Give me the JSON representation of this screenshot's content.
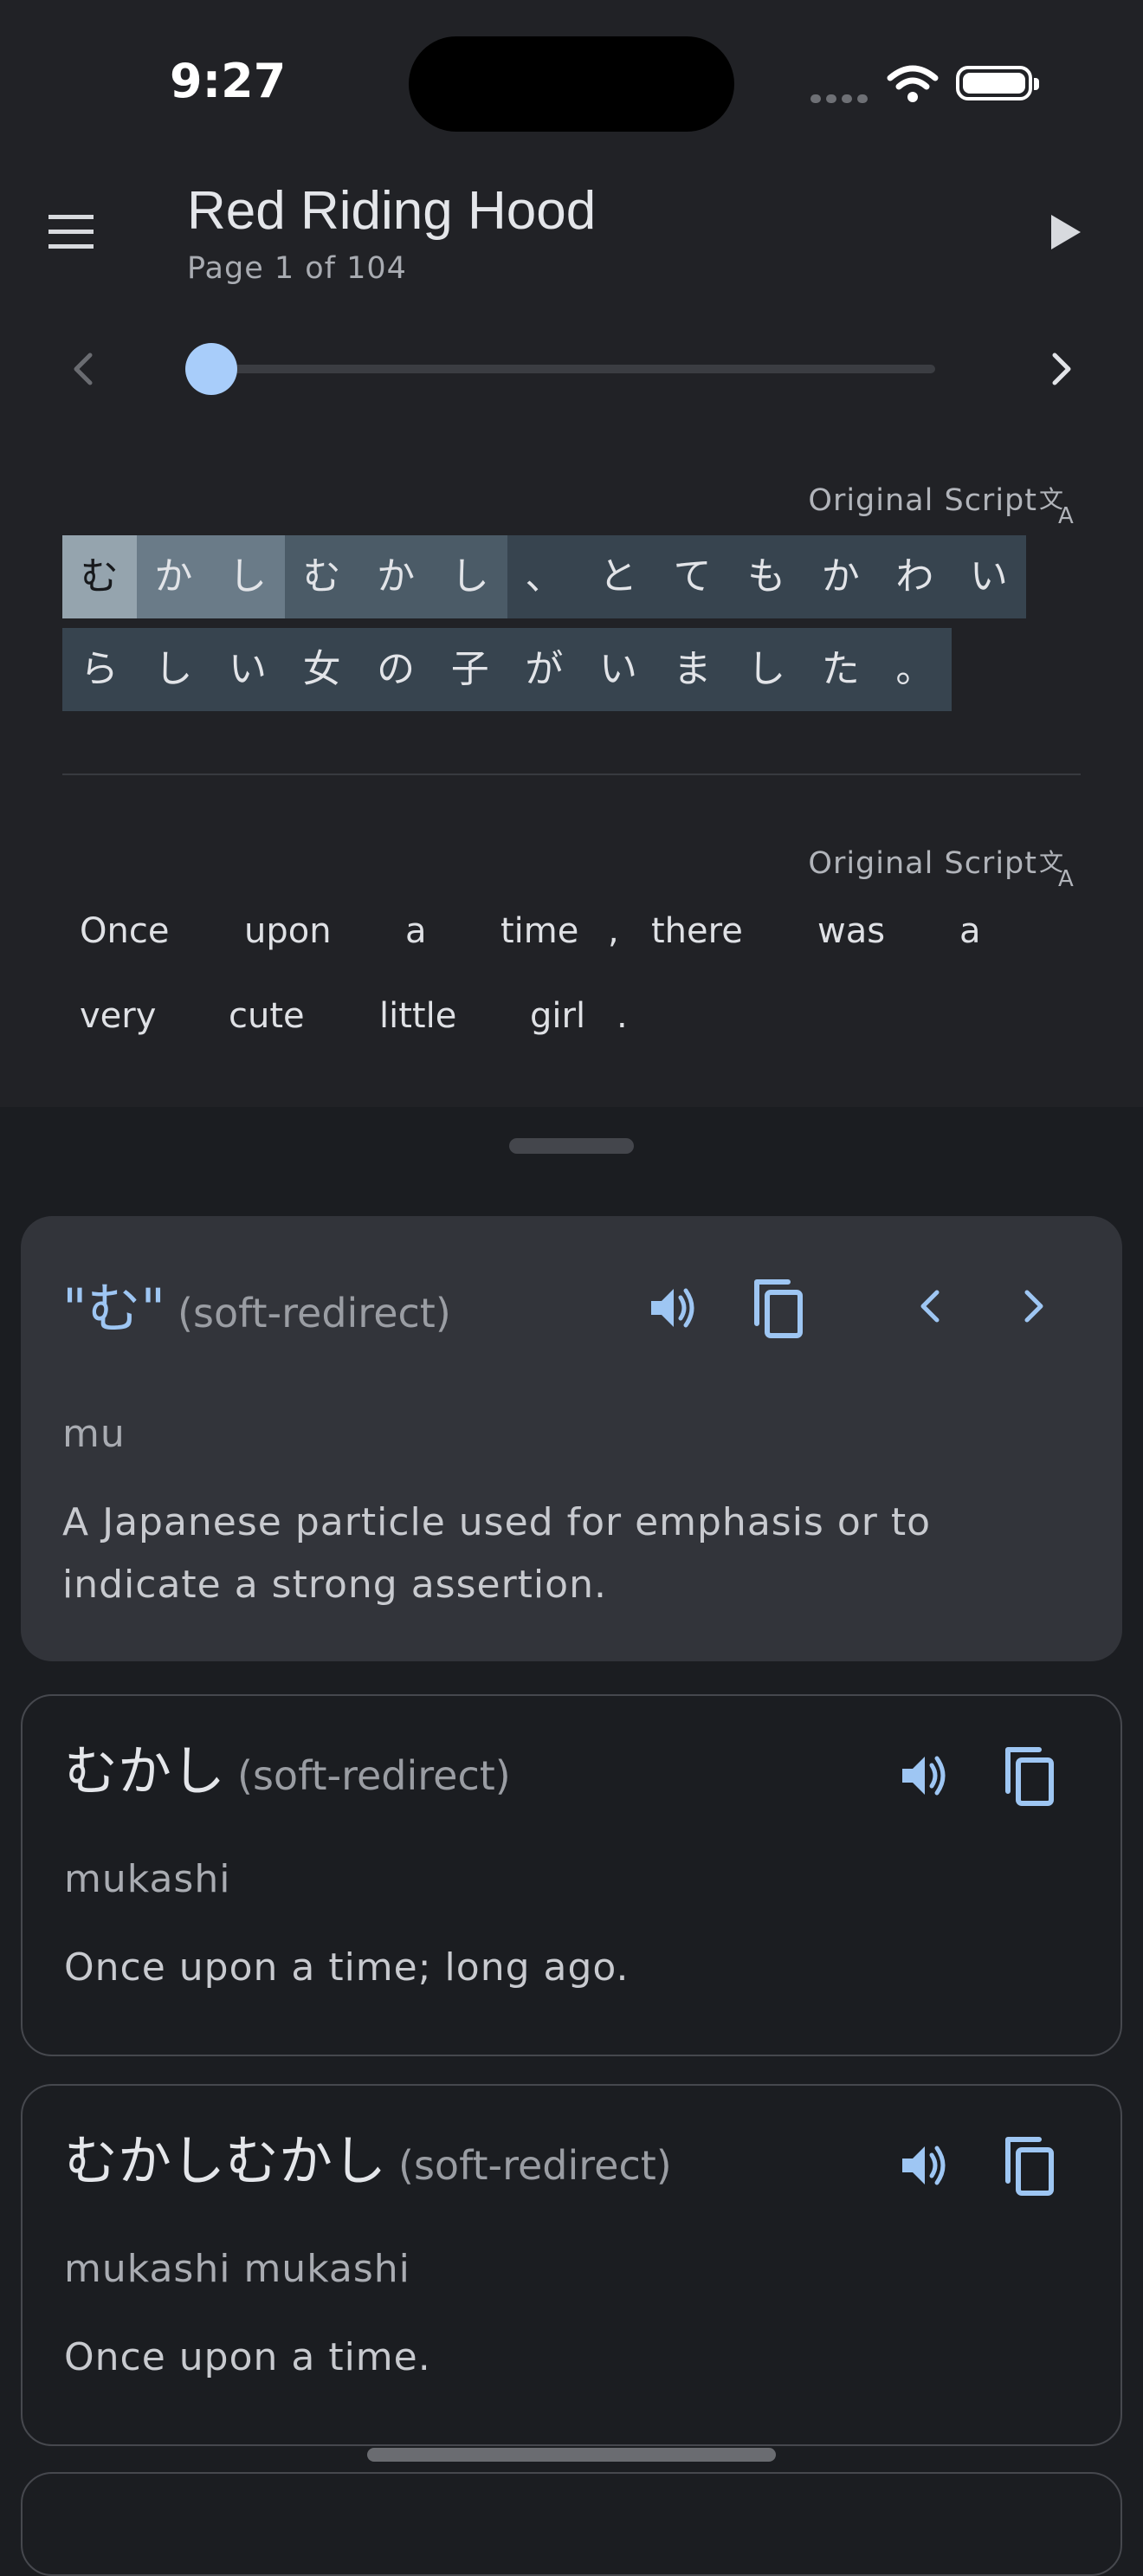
{
  "status_bar": {
    "time": "9:27"
  },
  "app_bar": {
    "title": "Red Riding Hood",
    "subtitle": "Page 1 of 104"
  },
  "slider": {
    "current_page": 1,
    "total_pages": 104
  },
  "original_section": {
    "label": "Original Script",
    "row1": [
      "む",
      "か",
      "し",
      "む",
      "か",
      "し",
      "、",
      "と",
      "て",
      "も",
      "か",
      "わ",
      "い"
    ],
    "row2": [
      "ら",
      "し",
      "い",
      "女",
      "の",
      "子",
      "が",
      "い",
      "ま",
      "し",
      "た",
      "。"
    ]
  },
  "translation_section": {
    "label": "Original Script",
    "words": [
      "Once",
      "upon",
      "a",
      "time",
      ",",
      "there",
      "was",
      "a",
      "very",
      "cute",
      "little",
      "girl",
      "."
    ]
  },
  "entries": [
    {
      "word": "\"む\"",
      "tag": "(soft-redirect)",
      "romanization": "mu",
      "definition": "A Japanese particle used for emphasis or to indicate a strong assertion."
    },
    {
      "word": "むかし",
      "tag": "(soft-redirect)",
      "romanization": "mukashi",
      "definition": "Once upon a time; long ago."
    },
    {
      "word": "むかしむかし",
      "tag": "(soft-redirect)",
      "romanization": "mukashi mukashi",
      "definition": "Once upon a time."
    }
  ],
  "colors": {
    "accent": "#9ec6f3",
    "background": "#1b1d21",
    "highlight_active": "#95a4ae"
  }
}
